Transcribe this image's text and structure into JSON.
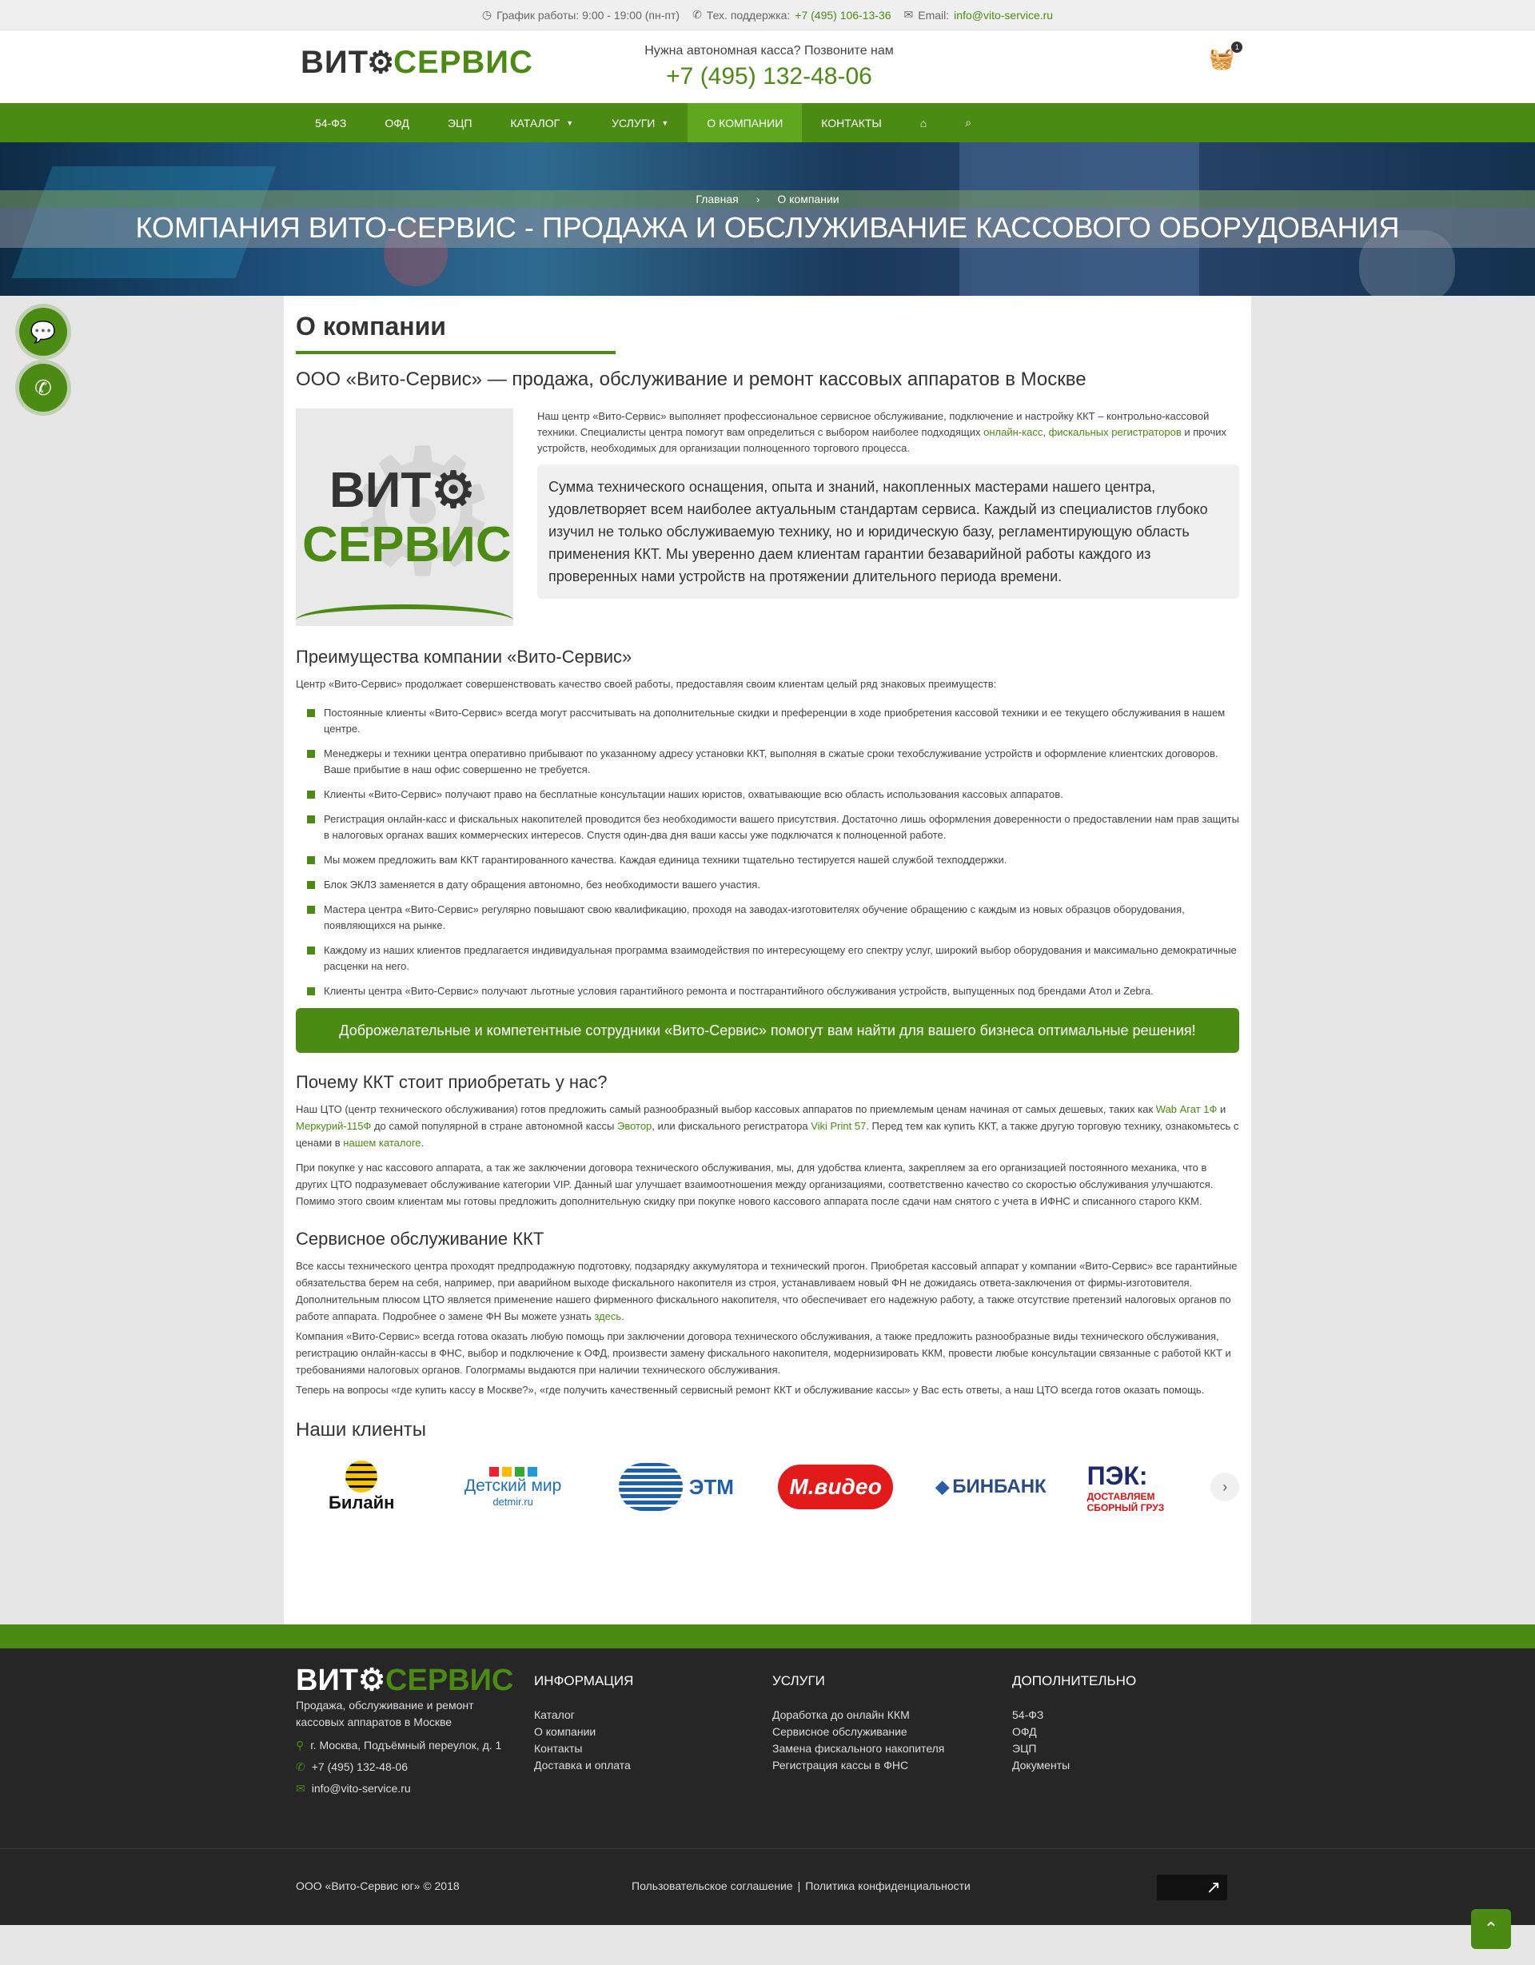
{
  "topbar": {
    "schedule": "График работы: 9:00 - 19:00 (пн-пт)",
    "support_label": "Тех. поддержка:",
    "support_phone": "+7 (495) 106-13-36",
    "email_label": "Email:",
    "email": "info@vito-service.ru"
  },
  "header": {
    "logo_left": "ВИТ",
    "logo_right": "СЕРВИС",
    "call_question": "Нужна автономная касса? Позвоните нам",
    "call_phone": "+7 (495) 132-48-06",
    "cart_count": "1"
  },
  "nav": {
    "items": [
      {
        "label": "54-ФЗ"
      },
      {
        "label": "ОФД"
      },
      {
        "label": "ЭЦП"
      },
      {
        "label": "КАТАЛОГ"
      },
      {
        "label": "УСЛУГИ"
      },
      {
        "label": "О КОМПАНИИ"
      },
      {
        "label": "КОНТАКТЫ"
      }
    ]
  },
  "hero": {
    "breadcrumb_home": "Главная",
    "breadcrumb_sep": "›",
    "breadcrumb_current": "О компании",
    "title": "КОМПАНИЯ ВИТО-СЕРВИС - ПРОДАЖА И ОБСЛУЖИВАНИЕ КАССОВОГО ОБОРУДОВАНИЯ"
  },
  "main": {
    "page_title": "О компании",
    "subtitle": "ООО «Вито-Сервис» — продажа, обслуживание и ремонт кассовых аппаратов в Москве",
    "intro_1": "Наш центр «Вито-Сервис» выполняет профессиональное сервисное обслуживание, подключение и настройку ККТ – контрольно-кассовой техники. Специалисты центра помогут вам определиться с выбором наиболее подходящих",
    "intro_link1": "онлайн-касс",
    "intro_comma": ",",
    "intro_link2": "фискальных регистраторов",
    "intro_2": "и прочих устройств, необходимых для организации полноценного торгового процесса.",
    "quote": "Сумма технического оснащения, опыта и знаний, накопленных мастерами нашего центра, удовлетворяет всем наиболее актуальным стандартам сервиса. Каждый из специалистов глубоко изучил не только обслуживаемую технику, но и юридическую базу, регламентирующую область применения ККТ. Мы уверенно даем клиентам гарантии безаварийной работы каждого из проверенных нами устройств на протяжении длительного периода времени.",
    "adv_title": "Преимущества компании «Вито-Сервис»",
    "adv_intro": "Центр «Вито-Сервис» продолжает совершенствовать качество своей работы, предоставляя своим клиентам целый ряд знаковых преимуществ:",
    "adv_items": [
      "Постоянные клиенты «Вито-Сервис» всегда могут рассчитывать на дополнительные скидки и преференции в ходе приобретения кассовой техники и ее текущего обслуживания в нашем центре.",
      "Менеджеры и техники центра оперативно прибывают по указанному адресу установки ККТ, выполняя в сжатые сроки техобслуживание устройств и оформление клиентских договоров. Ваше прибытие в наш офис совершенно не требуется.",
      "Клиенты «Вито-Сервис» получают право на бесплатные консультации наших юристов, охватывающие всю область использования кассовых аппаратов.",
      "Регистрация онлайн-касс и фискальных накопителей проводится без необходимости вашего присутствия. Достаточно лишь оформления доверенности о предоставлении нам прав защиты в налоговых органах ваших коммерческих интересов. Спустя один-два дня ваши кассы уже подключатся к полноценной работе.",
      "Мы можем предложить вам ККТ гарантированного качества. Каждая единица техники тщательно тестируется нашей службой техподдержки.",
      "Блок ЭКЛЗ заменяется в дату обращения автономно, без необходимости вашего участия.",
      "Мастера центра «Вито-Сервис» регулярно повышают свою квалификацию, проходя на заводах-изготовителях обучение обращению с каждым из новых образцов оборудования, появляющихся на рынке.",
      "Каждому из наших клиентов предлагается индивидуальная программа взаимодействия по интересующему его спектру услуг, широкий выбор оборудования и максимально демократичные расценки на него.",
      "Клиенты центра «Вито-Сервис» получают льготные условия гарантийного ремонта и постгарантийного обслуживания устройств, выпущенных под брендами Атол и Zebra."
    ],
    "banner": "Доброжелательные и компетентные сотрудники «Вито-Сервис» помогут вам найти для вашего бизнеса оптимальные решения!",
    "why_title": "Почему ККТ стоит приобретать у нас?",
    "why_p1_a": "Наш ЦТО (центр технического обслуживания) готов предложить самый разнообразный выбор кассовых аппаратов по приемлемым ценам начиная от самых дешевых, таких как",
    "why_link1": "Wab Агат 1Ф",
    "why_and": "и",
    "why_link2": "Меркурий-115Ф",
    "why_p1_b": "до самой популярной в стране автономной кассы",
    "why_link3": "Эвотор",
    "why_p1_c": ", или фискального регистратора",
    "why_link4": "Viki Print 57",
    "why_p1_d": ". Перед тем как купить ККТ, а также другую торговую технику, ознакомьтесь с ценами в",
    "why_link5": "нашем каталоге",
    "why_p1_e": ".",
    "why_p2": "При покупке у нас кассового аппарата, а так же заключении договора технического обслуживания, мы, для удобства клиента, закрепляем за его организацией постоянного механика, что в других ЦТО подразумевает обслуживание категории VIP. Данный шаг улучшает взаимоотношения между организациями, соответственно качество со скоростью обслуживания улучшаются. Помимо этого своим клиентам мы готовы предложить дополнительную скидку при покупке нового кассового аппарата после сдачи нам снятого с учета в ИФНС и списанного старого ККМ.",
    "svc_title": "Сервисное обслуживание ККТ",
    "svc_p1": "Все кассы технического центра проходят предпродажную подготовку, подзарядку аккумулятора и технический прогон. Приобретая кассовый аппарат у компании «Вито-Сервис» все гарантийные обязательства берем на себя, например, при аварийном выходе фискального накопителя из строя, устанавливаем новый ФН не дожидаясь ответа-заключения от фирмы-изготовителя. Дополнительным плюсом ЦТО является применение нашего фирменного фискального накопителя, что обеспечивает его надежную работу, а также отсутствие претензий налоговых органов по работе аппарата. Подробнее о замене ФН Вы можете узнать",
    "svc_link": "здесь",
    "svc_p1_end": ".",
    "svc_p2": "Компания «Вито-Сервис» всегда готова оказать любую помощь при заключении договора технического обслуживания, а также предложить разнообразные виды технического обслуживания, регистрацию онлайн-кассы в ФНС, выбор и подключение к ОФД, произвести замену фискального накопителя, модернизировать ККМ, провести любые консультации связанные с работой ККТ и требованиями налоговых органов. Гологрмамы выдаются при наличии технического обслуживания.",
    "svc_p3": "Теперь на вопросы «где купить кассу в Москве?», «где получить качественный сервисный ремонт ККТ и обслуживание кассы» у Вас есть ответы, а наш ЦТО всегда готов оказать помощь.",
    "clients_title": "Наши клиенты",
    "clients": [
      {
        "name": "Билайн"
      },
      {
        "name": "Детский мир",
        "sub": "detmir.ru"
      },
      {
        "name": "ЭТМ"
      },
      {
        "name": "М.видео"
      },
      {
        "name": "БИНБАНК"
      },
      {
        "name": "ПЭК:",
        "sub1": "ДОСТАВЛЯЕМ",
        "sub2": "СБОРНЫЙ ГРУЗ"
      }
    ]
  },
  "footer": {
    "desc": "Продажа, обслуживание и ремонт кассовых аппаратов в Москве",
    "address": "г. Москва, Подъёмный переулок, д. 1",
    "phone": "+7 (495) 132-48-06",
    "email": "info@vito-service.ru",
    "col_info_title": "ИНФОРМАЦИЯ",
    "col_info": [
      "Каталог",
      "О компании",
      "Контакты",
      "Доставка и оплата"
    ],
    "col_services_title": "УСЛУГИ",
    "col_services": [
      "Доработка до онлайн ККМ",
      "Сервисное обслуживание",
      "Замена фискального накопителя",
      "Регистрация кассы в ФНС"
    ],
    "col_extra_title": "ДОПОЛНИТЕЛЬНО",
    "col_extra": [
      "54-ФЗ",
      "ОФД",
      "ЭЦП",
      "Документы"
    ],
    "copyright": "ООО «Вито-Сервис юг» © 2018",
    "agreement": "Пользовательское соглашение",
    "sep": "|",
    "privacy": "Политика конфиденциальности"
  },
  "colors": {
    "brand_green": "#4b8b13",
    "footer_bg": "#262626"
  }
}
